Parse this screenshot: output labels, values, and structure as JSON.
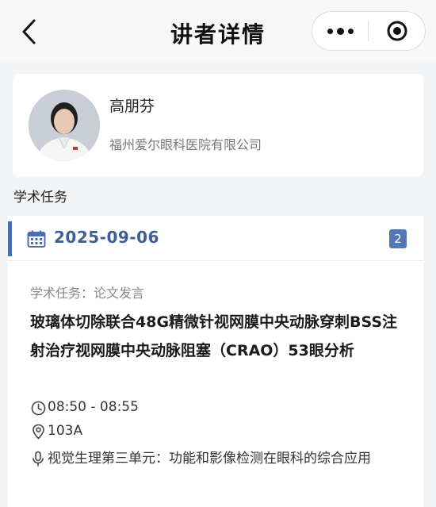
{
  "navbar": {
    "title": "讲者详情",
    "back_icon": "chevron-left-icon",
    "more_icon": "more-dots-icon",
    "close_icon": "target-close-icon"
  },
  "speaker": {
    "name": "高朋芬",
    "organization": "福州爱尔眼科医院有限公司"
  },
  "section": {
    "title": "学术任务"
  },
  "task": {
    "date": "2025-09-06",
    "count": "2",
    "type": "学术任务：论文发言",
    "title": "玻璃体切除联合48G精微针视网膜中央动脉穿刺BSS注射治疗视网膜中央动脉阻塞（CRAO）53眼分析",
    "time": "08:50 - 08:55",
    "room": "103A",
    "session": "视觉生理第三单元：功能和影像检测在眼科的综合应用"
  },
  "colors": {
    "accent": "#4a6fb0",
    "date_text": "#3f5f94",
    "badge": "#5577b6",
    "page_bg": "#f3f4f6"
  }
}
